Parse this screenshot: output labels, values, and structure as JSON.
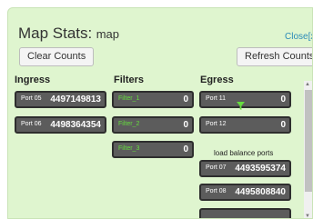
{
  "header": {
    "title": "Map Stats:",
    "map_name": "map",
    "close_label": "Close[x]"
  },
  "toolbar": {
    "clear_label": "Clear Counts",
    "refresh_label": "Refresh Counts"
  },
  "columns": {
    "ingress": "Ingress",
    "filters": "Filters",
    "egress": "Egress"
  },
  "ingress": [
    {
      "name": "Port 05",
      "value": "4497149813"
    },
    {
      "name": "Port 06",
      "value": "4498364354"
    }
  ],
  "filters": [
    {
      "name": "Filter_1",
      "value": "0"
    },
    {
      "name": "Filter_2",
      "value": "0"
    },
    {
      "name": "Filter_3",
      "value": "0"
    }
  ],
  "egress": [
    {
      "name": "Port 11",
      "value": "0",
      "icon": "filter-funnel-icon"
    },
    {
      "name": "Port 12",
      "value": "0"
    }
  ],
  "load_balance": {
    "label": "load balance ports",
    "ports": [
      {
        "name": "Port 07",
        "value": "4493595374"
      },
      {
        "name": "Port 08",
        "value": "4495808840"
      }
    ]
  },
  "colors": {
    "panel_bg": "#dff5cf",
    "port_bg": "#5c5c5c",
    "filter_text": "#66dd3e",
    "link": "#2a8ab8"
  }
}
